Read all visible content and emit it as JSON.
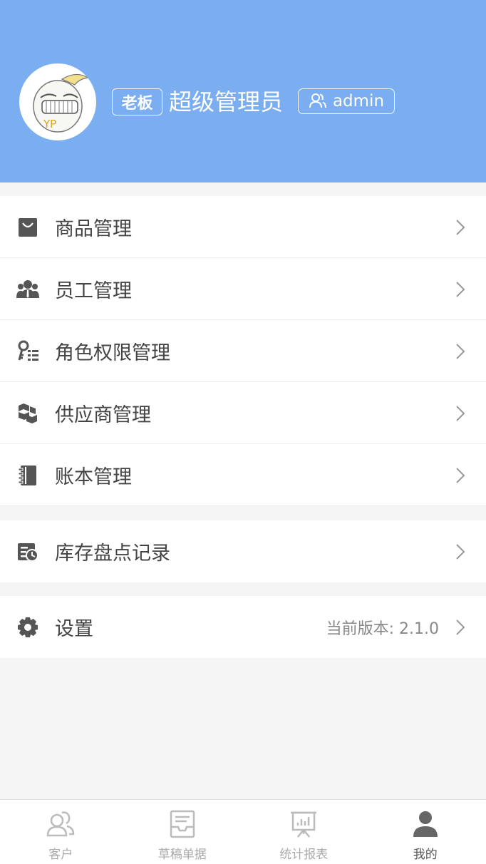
{
  "header": {
    "role_badge": "老板",
    "user_name": "超级管理员",
    "account": "admin",
    "background_color": "#7aaef0",
    "avatar_text": "YP"
  },
  "menu_group_1": [
    {
      "label": "商品管理",
      "icon": "shopping-bag-icon"
    },
    {
      "label": "员工管理",
      "icon": "staff-group-icon"
    },
    {
      "label": "角色权限管理",
      "icon": "key-permission-icon"
    },
    {
      "label": "供应商管理",
      "icon": "boxes-stack-icon"
    },
    {
      "label": "账本管理",
      "icon": "ledger-book-icon"
    }
  ],
  "menu_group_2": [
    {
      "label": "库存盘点记录",
      "icon": "inventory-record-icon"
    }
  ],
  "menu_group_3": [
    {
      "label": "设置",
      "icon": "gear-icon",
      "value": "当前版本: 2.1.0"
    }
  ],
  "tabbar": {
    "items": [
      {
        "label": "客户",
        "icon": "customers-icon",
        "active": false
      },
      {
        "label": "草稿单据",
        "icon": "draft-inbox-icon",
        "active": false
      },
      {
        "label": "统计报表",
        "icon": "report-board-icon",
        "active": false
      },
      {
        "label": "我的",
        "icon": "person-icon",
        "active": true
      }
    ],
    "active_color": "#666666",
    "inactive_color": "#bbbbbb"
  }
}
